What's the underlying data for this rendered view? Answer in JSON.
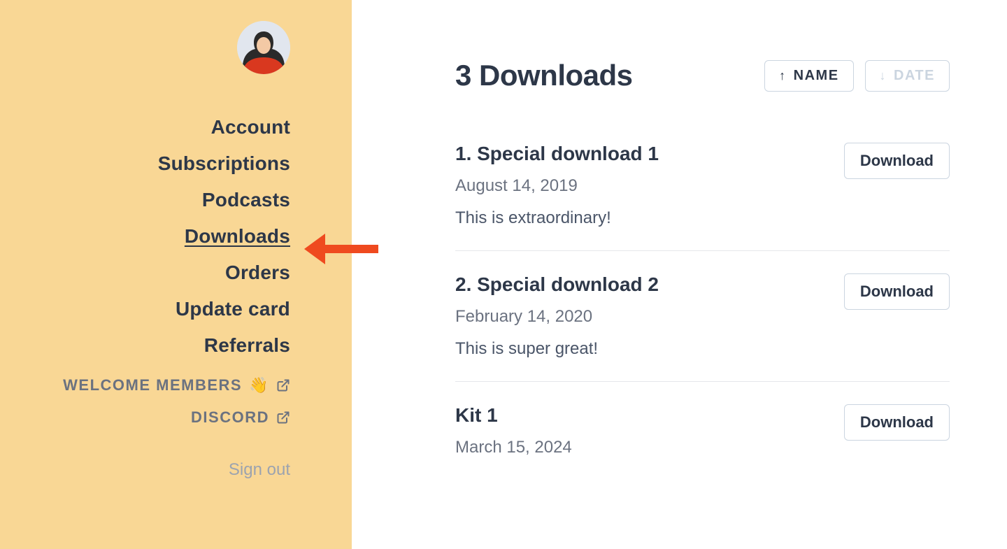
{
  "sidebar": {
    "nav": {
      "account": "Account",
      "subscriptions": "Subscriptions",
      "podcasts": "Podcasts",
      "downloads": "Downloads",
      "orders": "Orders",
      "update_card": "Update card",
      "referrals": "Referrals"
    },
    "ext": {
      "welcome": "WELCOME MEMBERS",
      "welcome_emoji": "👋",
      "discord": "DISCORD"
    },
    "signout": "Sign out",
    "active": "downloads"
  },
  "main": {
    "title": "3 Downloads",
    "sort": {
      "name": "NAME",
      "date": "DATE"
    },
    "download_btn": "Download",
    "items": [
      {
        "title": "1. Special download 1",
        "date": "August 14, 2019",
        "desc": "This is extraordinary!"
      },
      {
        "title": "2. Special download 2",
        "date": "February 14, 2020",
        "desc": "This is super great!"
      },
      {
        "title": "Kit 1",
        "date": "March 15, 2024",
        "desc": ""
      }
    ]
  },
  "colors": {
    "sidebar_bg": "#f9d795",
    "arrow": "#ef4a1f",
    "text": "#2d3748",
    "muted": "#6b7280",
    "border": "#cbd5e0"
  }
}
